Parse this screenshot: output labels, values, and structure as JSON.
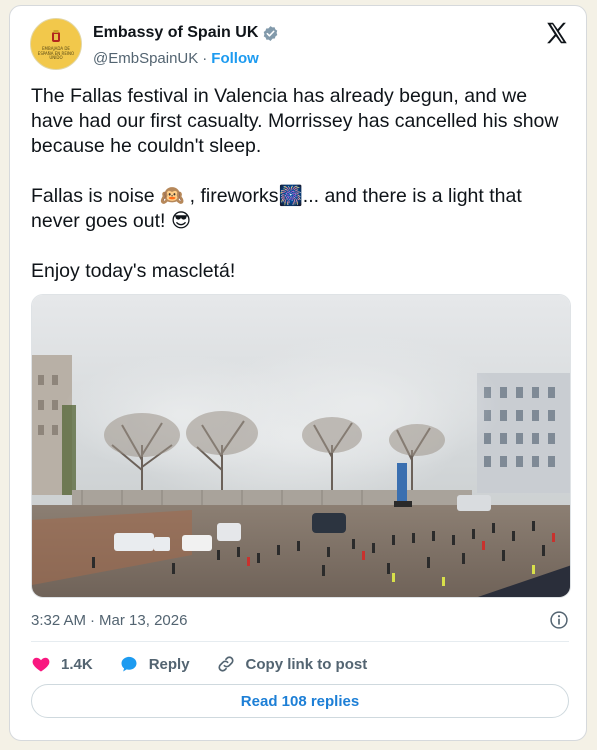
{
  "account": {
    "display_name": "Embassy of Spain UK",
    "handle": "@EmbSpainUK",
    "separator": "·",
    "follow_label": "Follow",
    "avatar_text": "EMBAJADA DE ESPAÑA EN REINO UNIDO"
  },
  "tweet": {
    "text": "The Fallas festival in Valencia has already begun, and we have had our first casualty. Morrissey has cancelled his show because he couldn't sleep.\n\nFallas is noise 🙉 , fireworks🎆... and there is a light that never goes out! 😎\n\nEnjoy today's mascletá!",
    "time": "3:32 AM",
    "separator": "·",
    "date": "Mar 13, 2026"
  },
  "actions": {
    "likes_count": "1.4K",
    "reply_label": "Reply",
    "copy_link_label": "Copy link to post",
    "read_replies_label": "Read 108 replies"
  },
  "colors": {
    "accent": "#1d9bf0",
    "like": "#f91880",
    "text": "#0f1419",
    "secondary": "#536471"
  },
  "icons": [
    "verified-badge-icon",
    "x-logo-icon",
    "info-icon",
    "heart-icon",
    "reply-bubble-icon",
    "link-icon"
  ]
}
